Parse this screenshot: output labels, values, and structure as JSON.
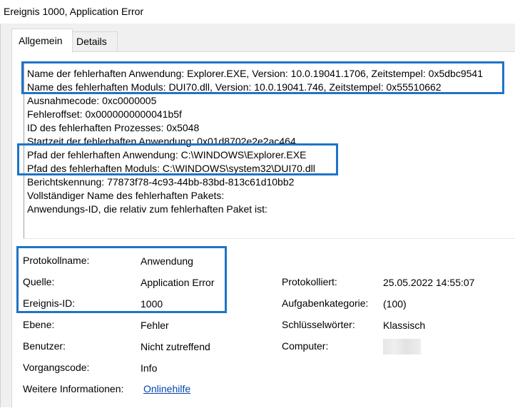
{
  "window": {
    "title": "Ereignis 1000, Application Error"
  },
  "tabs": [
    {
      "label": "Allgemein"
    },
    {
      "label": "Details"
    }
  ],
  "description": {
    "lines": [
      "Name der fehlerhaften Anwendung: Explorer.EXE, Version: 10.0.19041.1706, Zeitstempel: 0x5dbc9541",
      "Name des fehlerhaften Moduls: DUI70.dll, Version: 10.0.19041.746, Zeitstempel: 0x55510662",
      "Ausnahmecode: 0xc0000005",
      "Fehleroffset: 0x0000000000041b5f",
      "ID des fehlerhaften Prozesses: 0x5048",
      "Startzeit der fehlerhaften Anwendung: 0x01d8702e2e2ac464",
      "Pfad der fehlerhaften Anwendung: C:\\WINDOWS\\Explorer.EXE",
      "Pfad des fehlerhaften Moduls: C:\\WINDOWS\\system32\\DUI70.dll",
      "Berichtskennung: 77873f78-4c93-44bb-83bd-813c61d10bb2",
      "Vollständiger Name des fehlerhaften Pakets:",
      "Anwendungs-ID, die relativ zum fehlerhaften Paket ist:"
    ]
  },
  "properties": {
    "log_name_label": "Protokollname:",
    "log_name_value": "Anwendung",
    "source_label": "Quelle:",
    "source_value": "Application Error",
    "logged_label": "Protokolliert:",
    "logged_value": "25.05.2022 14:55:07",
    "event_id_label": "Ereignis-ID:",
    "event_id_value": "1000",
    "task_category_label": "Aufgabenkategorie:",
    "task_category_value": "(100)",
    "level_label": "Ebene:",
    "level_value": "Fehler",
    "keywords_label": "Schlüsselwörter:",
    "keywords_value": "Klassisch",
    "user_label": "Benutzer:",
    "user_value": "Nicht zutreffend",
    "computer_label": "Computer:",
    "opcode_label": "Vorgangscode:",
    "opcode_value": "Info",
    "more_info_label": "Weitere Informationen:",
    "more_info_link": "Onlinehilfe"
  },
  "colors": {
    "highlight_border": "#1f74c6",
    "link": "#0645ad"
  }
}
